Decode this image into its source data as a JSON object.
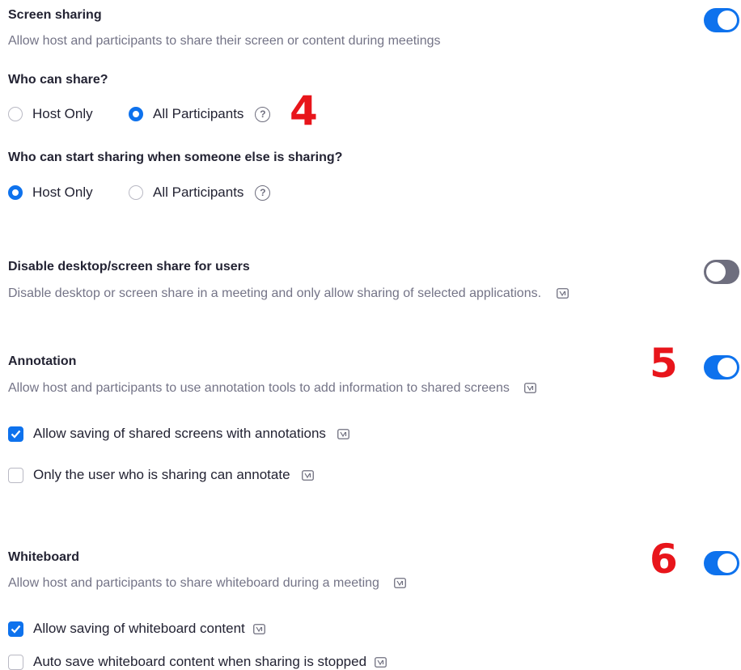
{
  "screen_sharing": {
    "title": "Screen sharing",
    "description": "Allow host and participants to share their screen or content during meetings",
    "toggle_state": "on",
    "who_can_share": {
      "label": "Who can share?",
      "options": [
        "Host Only",
        "All Participants"
      ],
      "selected": "All Participants"
    },
    "who_can_start": {
      "label": "Who can start sharing when someone else is sharing?",
      "options": [
        "Host Only",
        "All Participants"
      ],
      "selected": "Host Only"
    }
  },
  "disable_desktop": {
    "title": "Disable desktop/screen share for users",
    "description": "Disable desktop or screen share in a meeting and only allow sharing of selected applications.",
    "toggle_state": "off"
  },
  "annotation": {
    "title": "Annotation",
    "description": "Allow host and participants to use annotation tools to add information to shared screens",
    "toggle_state": "on",
    "options": [
      {
        "label": "Allow saving of shared screens with annotations",
        "checked": true
      },
      {
        "label": "Only the user who is sharing can annotate",
        "checked": false
      }
    ]
  },
  "whiteboard": {
    "title": "Whiteboard",
    "description": "Allow host and participants to share whiteboard during a meeting",
    "toggle_state": "on",
    "options": [
      {
        "label": "Allow saving of whiteboard content",
        "checked": true
      },
      {
        "label": "Auto save whiteboard content when sharing is stopped",
        "checked": false
      }
    ]
  },
  "annotations_overlay": [
    "4",
    "5",
    "6"
  ],
  "icons": {
    "help": "question-circle-icon",
    "lock": "locked-setting-icon",
    "check": "checkmark-icon"
  },
  "colors": {
    "accent": "#0e72ed",
    "toggle_off": "#6e6e7e",
    "annotation_red": "#e8151b",
    "description_gray": "#747487"
  }
}
